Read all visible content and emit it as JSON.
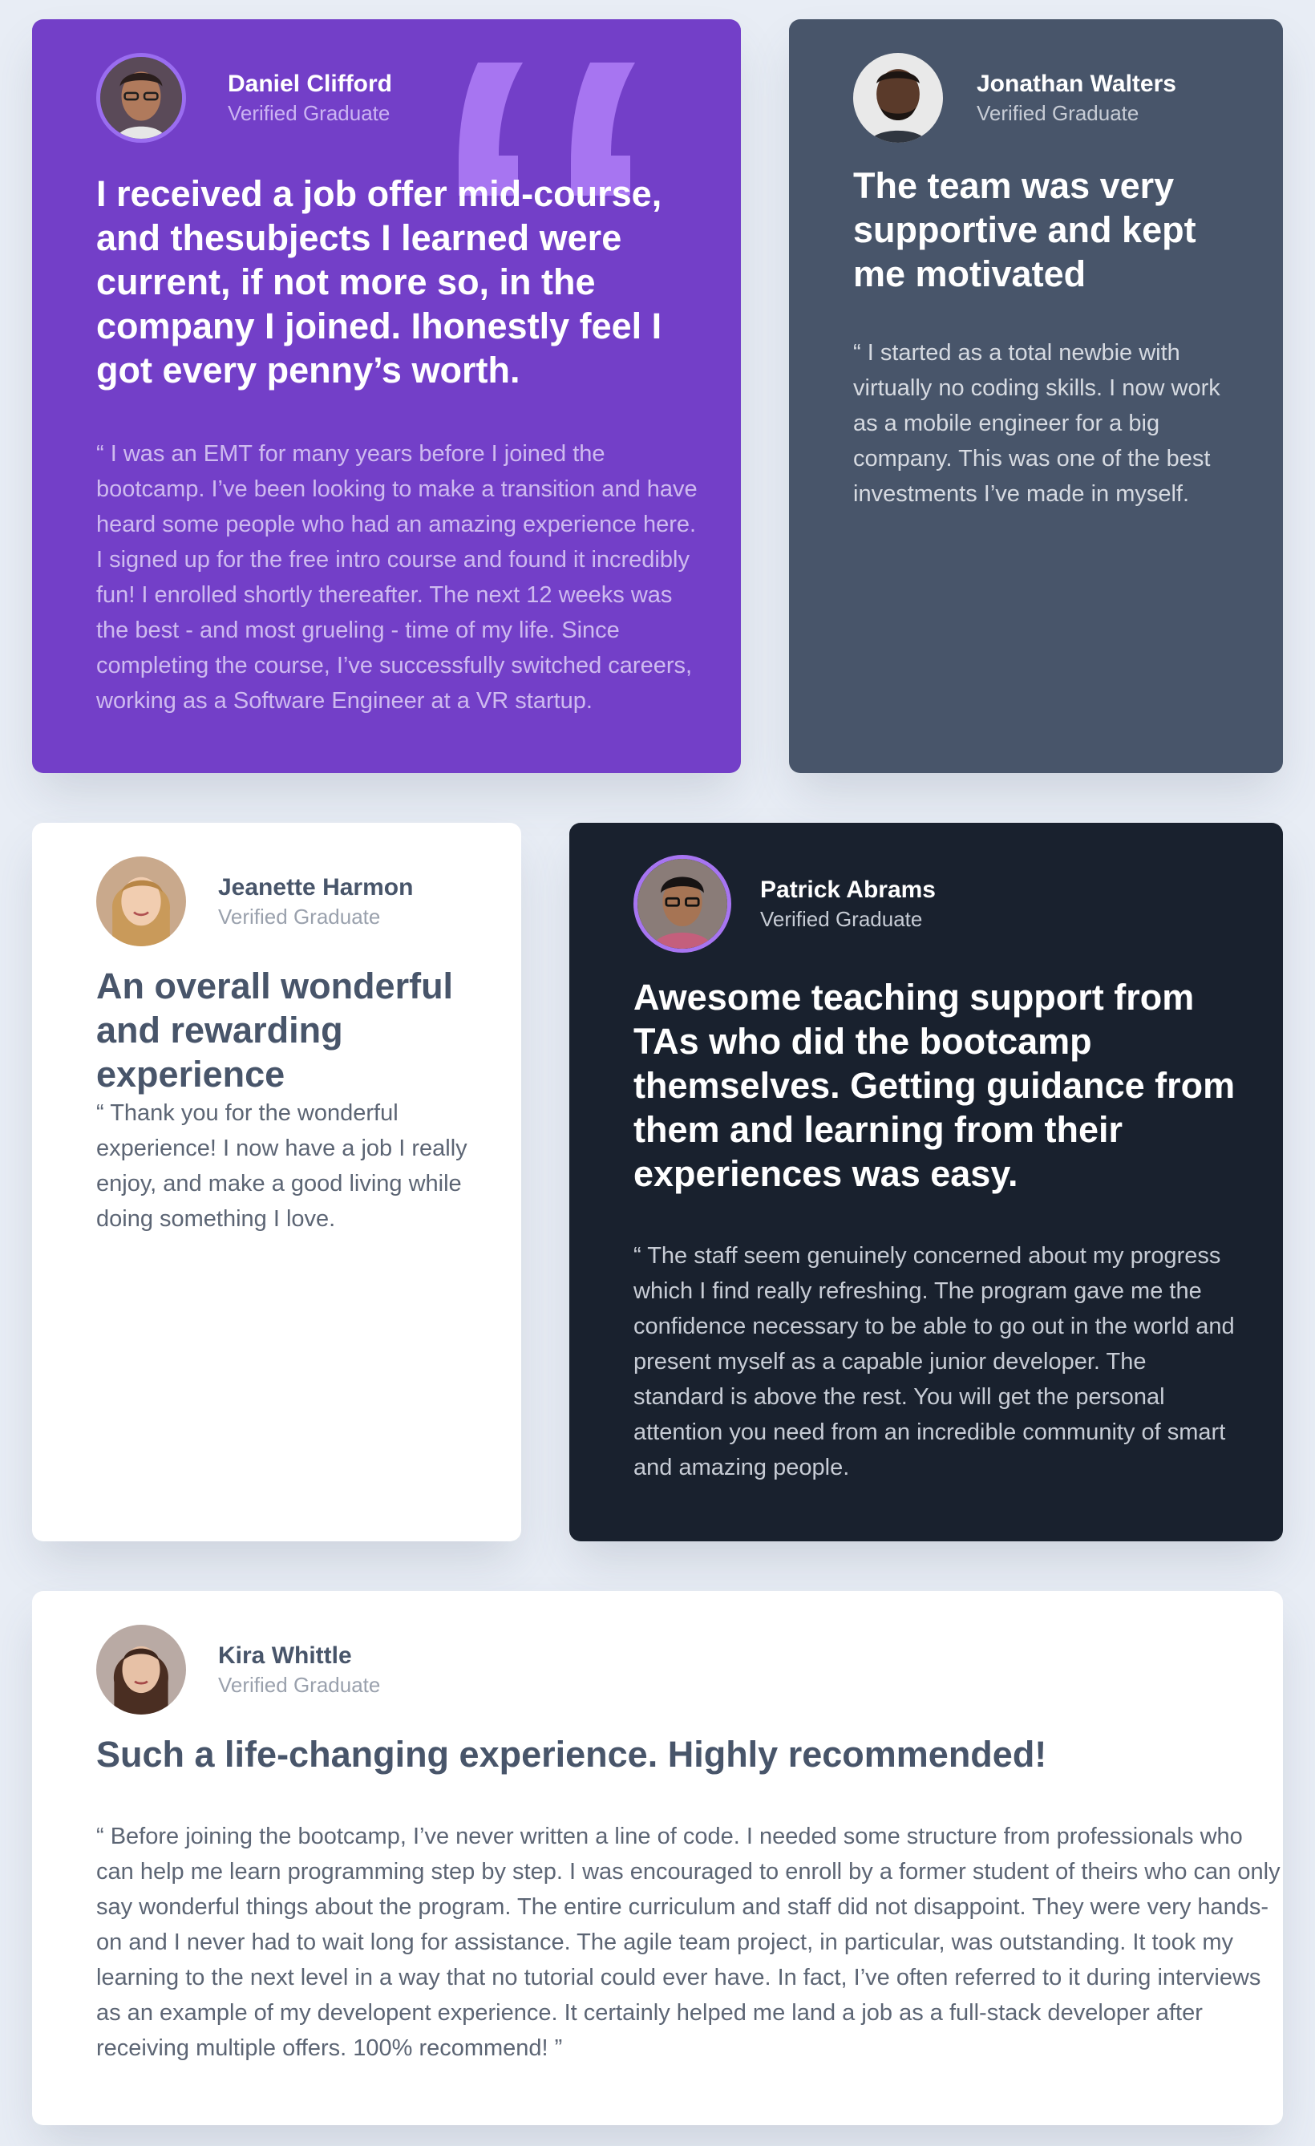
{
  "testimonials": [
    {
      "name": "Daniel Clifford",
      "status": "Verified Graduate",
      "headline": "I received a job offer mid-course, and thesubjects I learned were current, if not more so, in the company I joined. Ihonestly feel I got every penny’s worth.",
      "quote": "“ I was an EMT for many years before I joined the bootcamp. I’ve been looking to make a transition and have heard some people who had an amazing experience here. I signed up for the free intro course and found it incredibly fun! I enrolled shortly thereafter. The next 12 weeks was the best - and most grueling - time of my life. Since completing the course, I’ve successfully switched careers, working as a Software Engineer at a VR startup."
    },
    {
      "name": "Jonathan Walters",
      "status": "Verified Graduate",
      "headline": "The team was very supportive and kept me motivated",
      "quote": "“ I started as a total newbie with virtually no coding skills. I now work as a mobile engineer for a big company. This was one of the best investments I’ve made in myself."
    },
    {
      "name": "Jeanette Harmon",
      "status": "Verified Graduate",
      "headline": "An overall wonderful and rewarding experience",
      "quote": "“ Thank you for the wonderful experience! I now have a job I really enjoy, and make a good living while doing something I love."
    },
    {
      "name": "Patrick Abrams",
      "status": "Verified Graduate",
      "headline": "Awesome teaching support from TAs who did the bootcamp themselves. Getting guidance from them and learning from their experiences was easy.",
      "quote": "“ The staff seem genuinely concerned about my progress which I find really refreshing. The program gave me the confidence necessary to be able to go out in the world and present myself as a capable junior developer. The standard is above the rest. You will get the personal attention you need from an incredible community of smart and amazing people."
    },
    {
      "name": "Kira Whittle",
      "status": "Verified Graduate",
      "headline": "Such a life-changing experience. Highly recommended!",
      "quote": "“ Before joining the bootcamp, I’ve never written a line of code. I needed some structure from professionals who can help me learn programming step by step. I was encouraged to enroll by a former student of theirs who can only say wonderful things about the program. The entire curriculum and staff did not disappoint. They were very hands-on and I never had to wait long for assistance. The agile team project, in particular, was outstanding. It took my learning to the next level in a way that no tutorial could ever have. In fact, I’ve often referred to it during interviews as an example of my developent experience. It certainly helped me land a job as a full-stack developer after receiving multiple offers. 100% recommend! ”"
    }
  ],
  "colors": {
    "purple": "#733fc8",
    "gray_blue": "#48556a",
    "white": "#ffffff",
    "dark": "#19212e",
    "background": "#e8edf5"
  }
}
